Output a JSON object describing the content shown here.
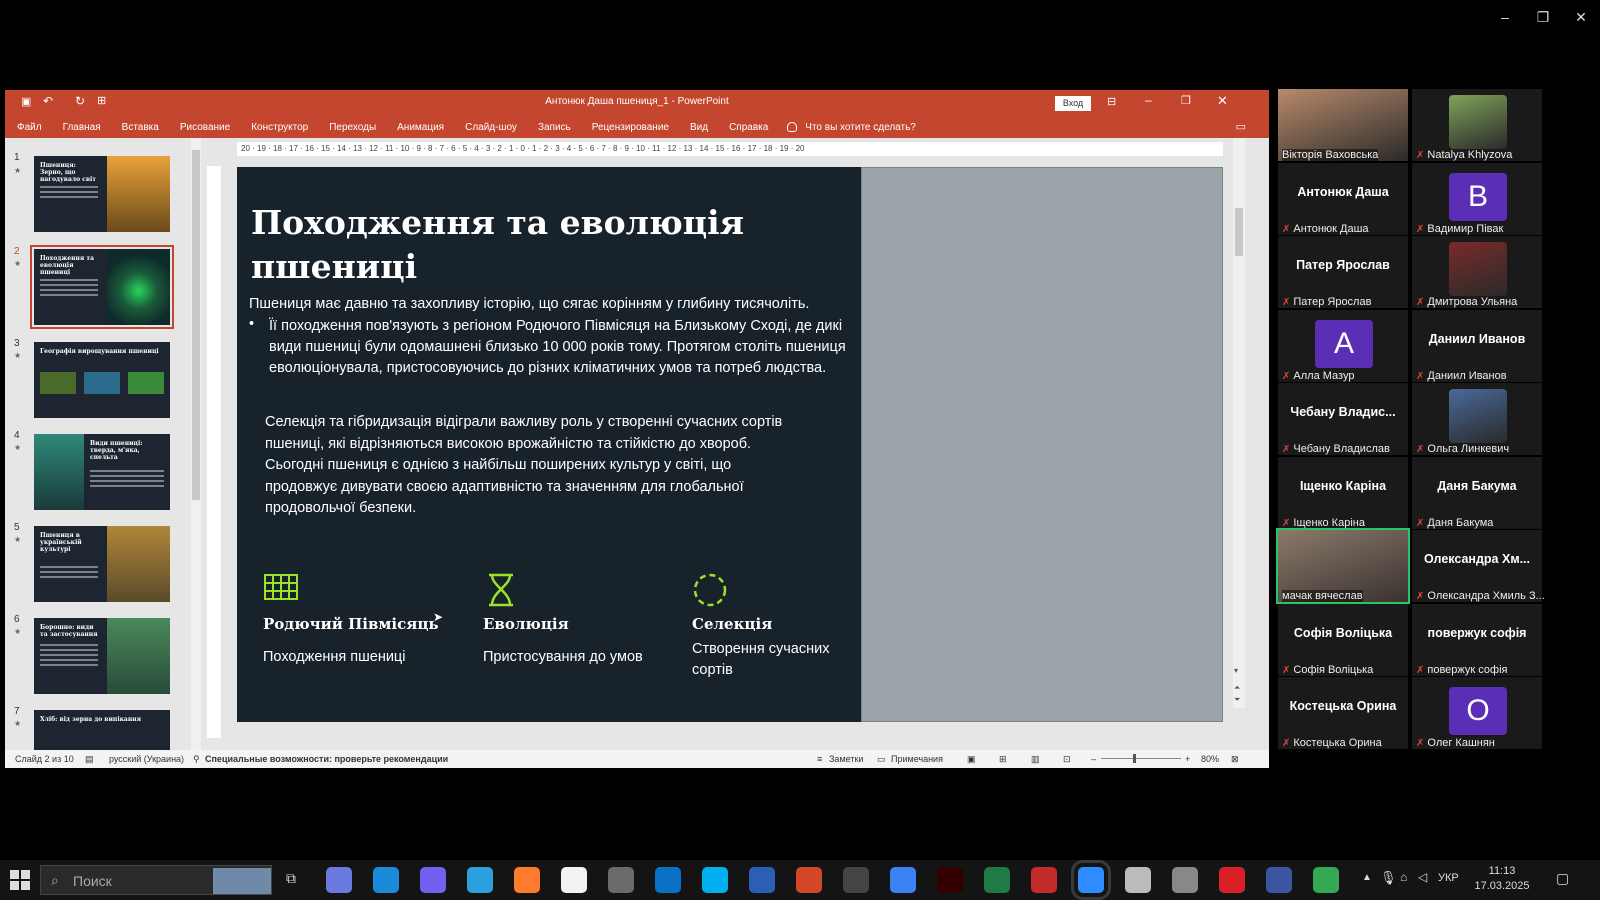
{
  "zoom": {
    "controls": [
      "–",
      "❐",
      "✕"
    ]
  },
  "ppt": {
    "title": "Антонюк Даша пшениця_1  -  PowerPoint",
    "login": "Вход",
    "menu": [
      "Файл",
      "Главная",
      "Вставка",
      "Рисование",
      "Конструктор",
      "Переходы",
      "Анимация",
      "Слайд-шоу",
      "Запись",
      "Рецензирование",
      "Вид",
      "Справка"
    ],
    "tell_me": "Что вы хотите сделать?",
    "ruler": "20 · 19 · 18 · 17 · 16 · 15 · 14 · 13 · 12 · 11 · 10 · 9 · 8 · 7 · 6 · 5 · 4 · 3 · 2 · 1 · 0 · 1 · 2 · 3 · 4 · 5 · 6 · 7 · 8 · 9 · 10 · 11 · 12 · 13 · 14 · 15 · 16 · 17 · 18 · 19 · 20",
    "thumbs": [
      {
        "num": "1",
        "title": "Пшениця: Зерно, що нагодувало світ",
        "img": "#d98b2a"
      },
      {
        "num": "2",
        "title": "Походження та еволюція пшениці",
        "img": "#1fa35a"
      },
      {
        "num": "3",
        "title": "Географія вирощування пшениці",
        "img": "#2b6e3b"
      },
      {
        "num": "4",
        "title": "Види пшениці: тверда, м'яка, спельта",
        "img": "#2e8a7a"
      },
      {
        "num": "5",
        "title": "Пшениця в українській культурі",
        "img": "#8a6a2a"
      },
      {
        "num": "6",
        "title": "Борошно: види та застосування",
        "img": "#3a7a4a"
      },
      {
        "num": "7",
        "title": "Хліб: від зерна до випікання",
        "img": "#5a4a3a"
      }
    ],
    "slide": {
      "title_line1": "Походження та еволюція",
      "title_line2": "пшениці",
      "intro": "Пшениця має давню та захопливу історію, що сягає корінням у глибину тисячоліть.",
      "bullet": "Її походження пов'язують з регіоном Родючого Півмісяця на Близькому Сході, де дикі види пшениці були одомашнені близько 10 000 років тому. Протягом століть пшениця еволюціонувала, пристосовуючись до різних кліматичних умов та потреб людства.",
      "para": "Селекція та гібридизація відіграли важливу роль у створенні сучасних сортів пшениці, які відрізняються високою врожайністю та стійкістю до хвороб. Сьогодні пшениця є однією з найбільш поширених культур у світі, що продовжує дивувати своєю адаптивністю та значенням для глобальної продовольчої безпеки.",
      "features": [
        {
          "title": "Родючий Півмісяць",
          "desc": "Походження пшениці",
          "icon": "grid-icon"
        },
        {
          "title": "Еволюція",
          "desc": "Пристосування до умов",
          "icon": "hourglass-icon"
        },
        {
          "title": "Селекція",
          "desc": "Створення сучасних сортів",
          "icon": "dashed-circle-icon"
        }
      ]
    },
    "status": {
      "slide_counter": "Слайд 2 из 10",
      "language": "русский (Украина)",
      "accessibility": "Специальные возможности: проверьте рекомендации",
      "notes": "Заметки",
      "comments": "Примечания",
      "zoom": "80%"
    }
  },
  "participants": [
    {
      "label": "Вікторія Ваховська",
      "type": "photo",
      "color": "#b88a6a",
      "big": ""
    },
    {
      "label": "Natalya Khlyzova",
      "type": "photo",
      "color": "#7fa35a",
      "big": ""
    },
    {
      "label": "Антонюк Даша",
      "type": "name",
      "big": "Антонюк Даша"
    },
    {
      "label": "Вадимир Півак",
      "type": "letter",
      "letter": "B",
      "color": "#5a2fb5"
    },
    {
      "label": "Патер Ярослав",
      "type": "name",
      "big": "Патер Ярослав"
    },
    {
      "label": "Дмитрова Ульяна",
      "type": "photo",
      "color": "#7a2a2a"
    },
    {
      "label": "Алла Мазур",
      "type": "letter",
      "letter": "A",
      "color": "#5a2fb5"
    },
    {
      "label": "Даниил Иванов",
      "type": "name",
      "big": "Даниил Иванов"
    },
    {
      "label": "Чебану Владислав",
      "type": "name",
      "big": "Чебану  Владис..."
    },
    {
      "label": "Ольга Линкевич",
      "type": "photo",
      "color": "#4a6a9a"
    },
    {
      "label": "Іщенко Каріна",
      "type": "name",
      "big": "Іщенко Каріна"
    },
    {
      "label": "Даня Бакума",
      "type": "name",
      "big": "Даня Бакума"
    },
    {
      "label": "мачак вячеслав",
      "type": "photo-full",
      "color": "#8a7a6a"
    },
    {
      "label": "Олександра Хмиль З...",
      "type": "name",
      "big": "Олександра  Хм..."
    },
    {
      "label": "Софія Воліцька",
      "type": "name",
      "big": "Софія Воліцька"
    },
    {
      "label": "повержук софія",
      "type": "name",
      "big": "повержук софія"
    },
    {
      "label": "Костецька Орина",
      "type": "name",
      "big": "Костецька Орина"
    },
    {
      "label": "Олег Кашнян",
      "type": "letter",
      "letter": "O",
      "color": "#5a2fb5"
    }
  ],
  "taskbar": {
    "search": "Поиск",
    "lang": "УКР",
    "time": "11:13",
    "date": "17.03.2025",
    "apps": [
      "copilot",
      "edge",
      "viber",
      "telegram",
      "firefox",
      "file",
      "calculator",
      "outlook",
      "skype",
      "word",
      "powerpoint",
      "clapper",
      "calendar",
      "illustrator",
      "excel",
      "tool",
      "zoom",
      "notepad",
      "paint",
      "cc",
      "visio",
      "drive"
    ]
  }
}
